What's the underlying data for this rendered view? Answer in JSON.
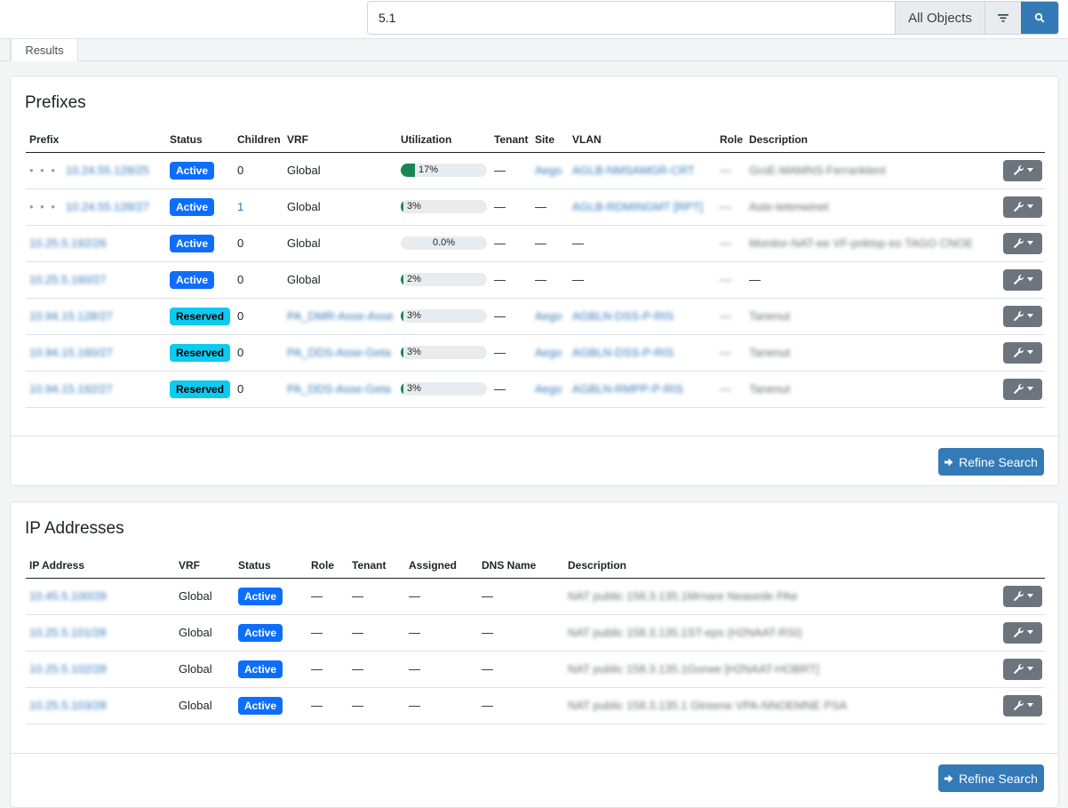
{
  "search": {
    "query": "5.1",
    "object_type": "All Objects"
  },
  "tabs": [
    {
      "label": "Results"
    }
  ],
  "prefixes": {
    "title": "Prefixes",
    "columns": [
      "Prefix",
      "Status",
      "Children",
      "VRF",
      "Utilization",
      "Tenant",
      "Site",
      "VLAN",
      "Role",
      "Description"
    ],
    "rows": [
      {
        "prefix": "10.24.55.128/25",
        "nested": true,
        "status": "Active",
        "children": "0",
        "vrf": "Global",
        "util": 17,
        "util_label": "17%",
        "tenant": "—",
        "site": "Aego",
        "vlan": "AGLB-NMSAMGR-CRT",
        "role": "—",
        "description": "GroE-MAMNS-Ferranktent"
      },
      {
        "prefix": "10.24.55.128/27",
        "nested": true,
        "status": "Active",
        "children": "1",
        "vrf": "Global",
        "util": 3,
        "util_label": "3%",
        "tenant": "—",
        "site": "—",
        "vlan": "AGLB-RDMINGMT [RPT]",
        "role": "—",
        "description": "Aste-tetenwinet"
      },
      {
        "prefix": "10.25.5.192/26",
        "nested": false,
        "status": "Active",
        "children": "0",
        "vrf": "Global",
        "util": 0,
        "util_label": "0.0%",
        "tenant": "—",
        "site": "—",
        "vlan": "—",
        "role": "—",
        "description": "Monitor-NAT-ee VF-pnktsp eo TAGO CNOE"
      },
      {
        "prefix": "10.25.5.160/27",
        "nested": false,
        "status": "Active",
        "children": "0",
        "vrf": "Global",
        "util": 2,
        "util_label": "2%",
        "tenant": "—",
        "site": "—",
        "vlan": "—",
        "role": "—",
        "description": "—"
      },
      {
        "prefix": "10.94.15.128/27",
        "nested": false,
        "status": "Reserved",
        "children": "0",
        "vrf": "PA_DMR-Asse-Asse",
        "util": 3,
        "util_label": "3%",
        "tenant": "—",
        "site": "Aego",
        "vlan": "AGBLN-DSS-P-RIS",
        "role": "—",
        "description": "Tanenut"
      },
      {
        "prefix": "10.94.15.160/27",
        "nested": false,
        "status": "Reserved",
        "children": "0",
        "vrf": "PA_DDS-Asse-Geta",
        "util": 3,
        "util_label": "3%",
        "tenant": "—",
        "site": "Aego",
        "vlan": "AGBLN-DSS-P-RIS",
        "role": "—",
        "description": "Tanenut"
      },
      {
        "prefix": "10.94.15.192/27",
        "nested": false,
        "status": "Reserved",
        "children": "0",
        "vrf": "PA_DDS-Asse-Geta",
        "util": 3,
        "util_label": "3%",
        "tenant": "—",
        "site": "Aego",
        "vlan": "AGBLN-RMPP-P-RIS",
        "role": "—",
        "description": "Tanenut"
      }
    ],
    "refine_label": "Refine Search"
  },
  "ip_addresses": {
    "title": "IP Addresses",
    "columns": [
      "IP Address",
      "VRF",
      "Status",
      "Role",
      "Tenant",
      "Assigned",
      "DNS Name",
      "Description"
    ],
    "rows": [
      {
        "address": "10.45.5.100/28",
        "vrf": "Global",
        "status": "Active",
        "role": "—",
        "tenant": "—",
        "assigned": "—",
        "dns": "—",
        "description": "NAT public 158.3.135.1Mrnare Neasede PAe"
      },
      {
        "address": "10.25.5.101/28",
        "vrf": "Global",
        "status": "Active",
        "role": "—",
        "tenant": "—",
        "assigned": "—",
        "dns": "—",
        "description": "NAT public 158.3.135.1ST-eps (H2NAAT-RSI)"
      },
      {
        "address": "10.25.5.102/28",
        "vrf": "Global",
        "status": "Active",
        "role": "—",
        "tenant": "—",
        "assigned": "—",
        "dns": "—",
        "description": "NAT public 158.3.135.1Gorwe [H2NAAT-HOBRT]"
      },
      {
        "address": "10.25.5.103/28",
        "vrf": "Global",
        "status": "Active",
        "role": "—",
        "tenant": "—",
        "assigned": "—",
        "dns": "—",
        "description": "NAT public 158.3.135.1 Gtreene VPA-NNOEMNE PSA"
      }
    ],
    "refine_label": "Refine Search"
  },
  "colors": {
    "primary": "#337ab7",
    "active": "#0d6efd",
    "reserved": "#0dcaf0",
    "util": "#198754"
  }
}
